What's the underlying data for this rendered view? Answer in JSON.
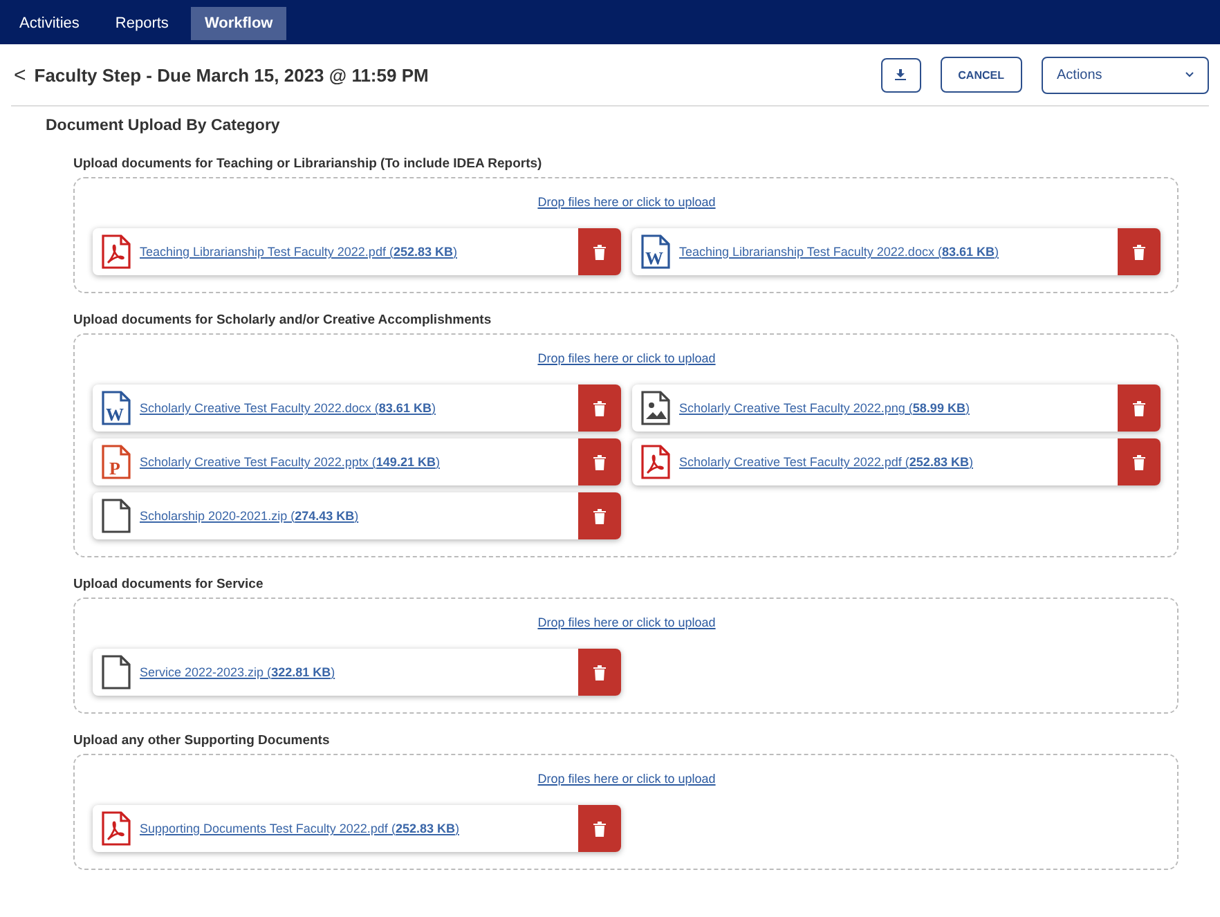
{
  "nav": {
    "tabs": [
      {
        "label": "Activities",
        "selected": false
      },
      {
        "label": "Reports",
        "selected": false
      },
      {
        "label": "Workflow",
        "selected": true
      }
    ]
  },
  "header": {
    "back": "<",
    "title": "Faculty Step - Due March 15, 2023 @ 11:59 PM",
    "cancel": "CANCEL",
    "actions": "Actions"
  },
  "page_title": "Document Upload By Category",
  "sections": [
    {
      "label": "Upload documents for Teaching or Librarianship (To include IDEA Reports)",
      "drop": "Drop files here or click to upload",
      "files": [
        {
          "kind": "pdf",
          "link": "Teaching Librarianship Test Faculty 2022.pdf (**252.83 KB**)"
        },
        {
          "kind": "word",
          "badge": "W",
          "link": "Teaching Librarianship Test Faculty 2022.docx (**83.61 KB**)"
        }
      ]
    },
    {
      "label": "Upload documents for Scholarly and/or Creative Accomplishments",
      "drop": "Drop files here or click to upload",
      "files": [
        {
          "kind": "word",
          "badge": "W",
          "link": "Scholarly Creative Test Faculty 2022.docx (**83.61 KB**)"
        },
        {
          "kind": "image",
          "link": "Scholarly Creative Test Faculty 2022.png (**58.99 KB**)"
        },
        {
          "kind": "powerpoint",
          "badge": "P",
          "link": "Scholarly Creative Test Faculty 2022.pptx (**149.21 KB**)"
        },
        {
          "kind": "pdf",
          "link": "Scholarly Creative Test Faculty 2022.pdf (**252.83 KB**)"
        },
        {
          "kind": "file",
          "link": "Scholarship 2020-2021.zip (**274.43 KB**)"
        }
      ]
    },
    {
      "label": "Upload documents for Service",
      "drop": "Drop files here or click to upload",
      "files": [
        {
          "kind": "file",
          "link": "Service 2022-2023.zip (**322.81 KB**)"
        }
      ]
    },
    {
      "label": "Upload any other Supporting Documents",
      "drop": "Drop files here or click to upload",
      "files": [
        {
          "kind": "pdf",
          "link": "Supporting Documents Test Faculty 2022.pdf (**252.83 KB**)"
        }
      ]
    }
  ]
}
